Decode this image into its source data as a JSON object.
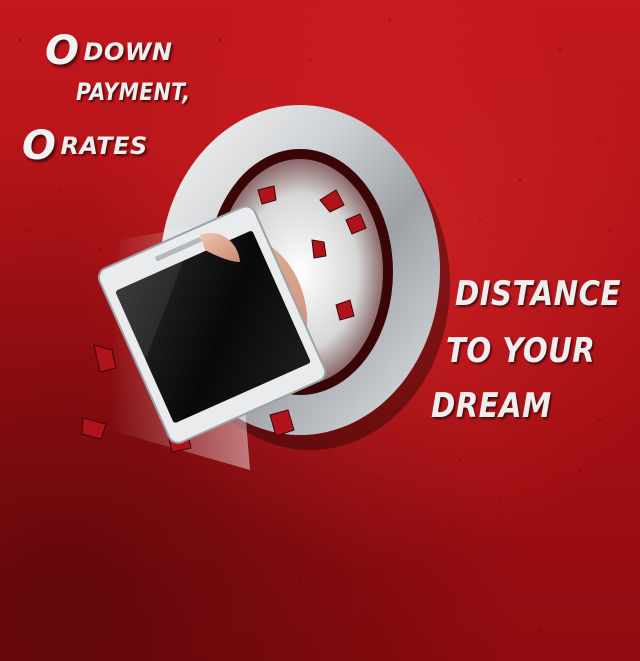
{
  "headline": {
    "line1_zero": "O",
    "line1_word": "DOWN",
    "line2": "PAYMENT,",
    "line3_zero": "O",
    "line3_word": "RATES"
  },
  "tagline": {
    "line1": "DISTANCE",
    "line2": "TO YOUR",
    "line3": "DREAM"
  },
  "colors": {
    "background": "#b51419",
    "text": "#eeeeee",
    "ring_metal": "#c9ccd0",
    "screen": "#111111"
  },
  "icons": [
    "metal-zero-ring-icon",
    "smartphone-icon",
    "hand-icon",
    "debris-icon"
  ]
}
